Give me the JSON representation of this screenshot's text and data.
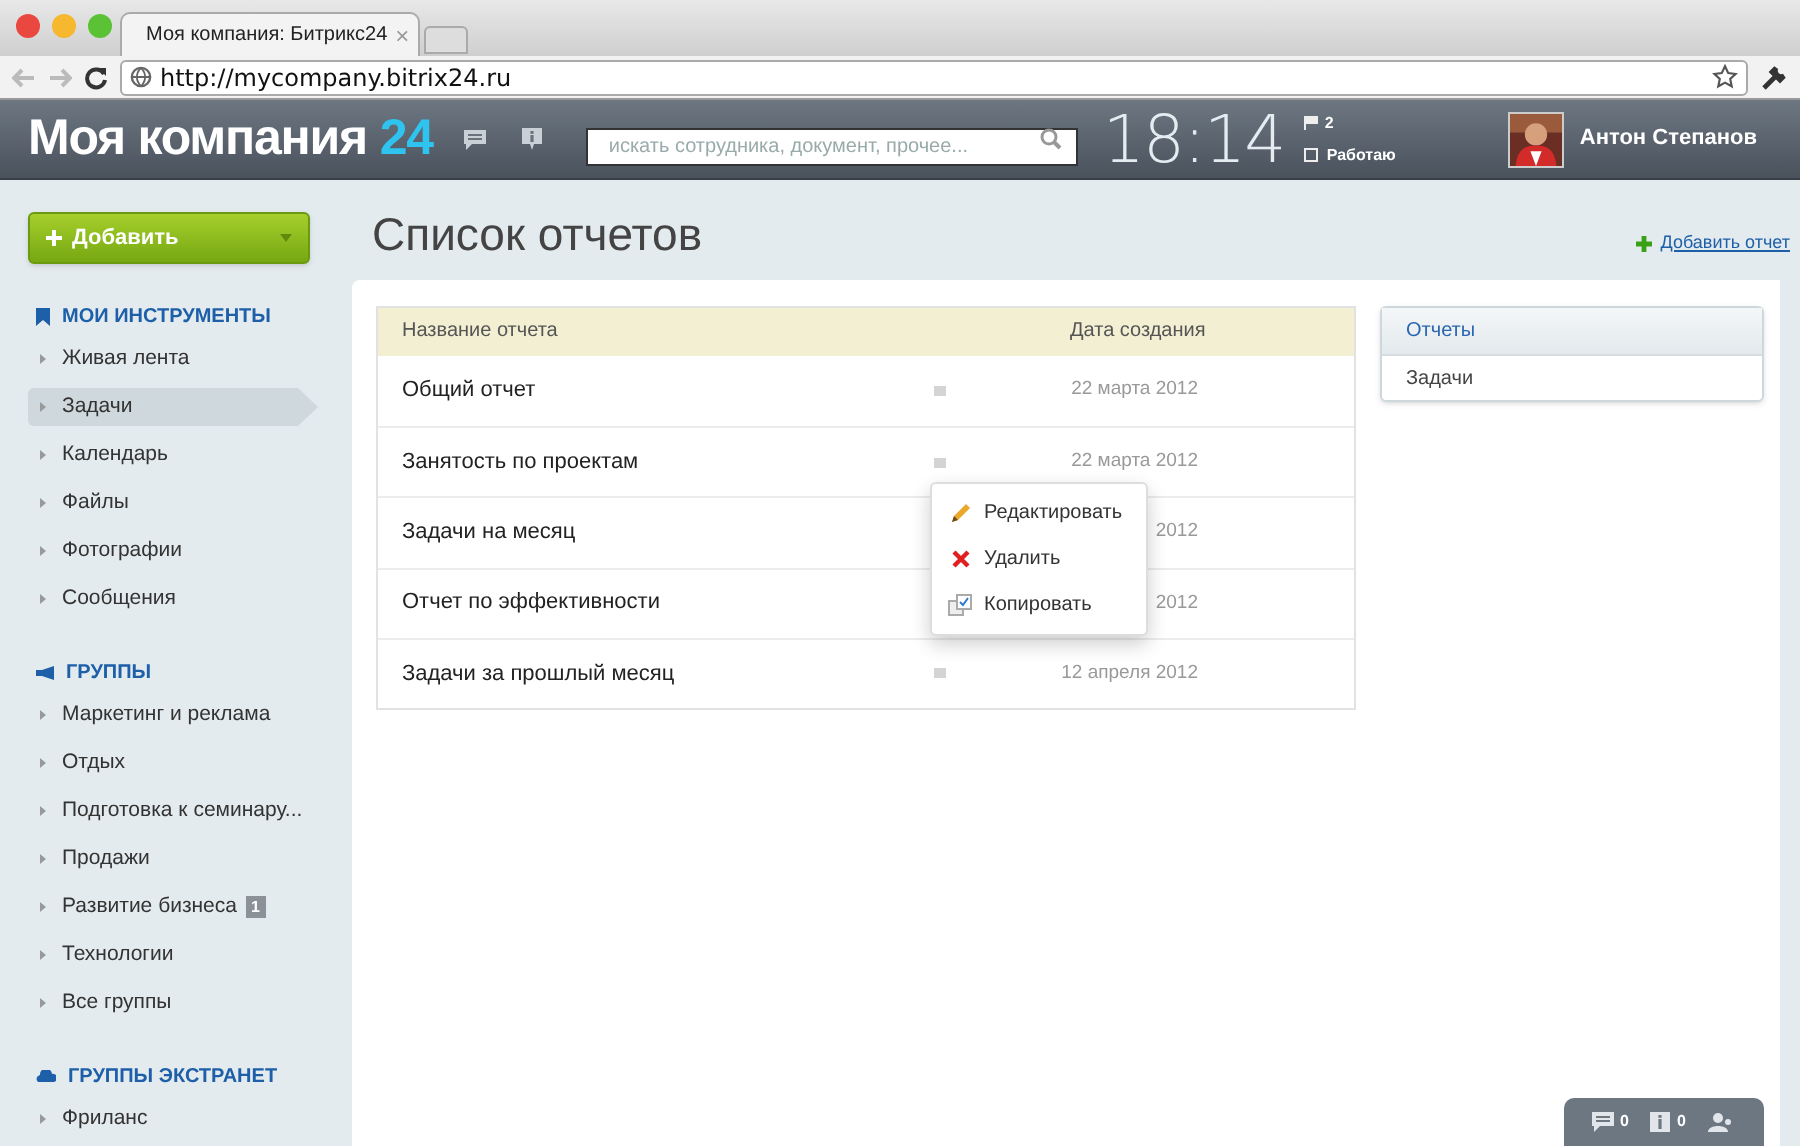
{
  "browser": {
    "tab_title": "Моя компания: Битрикс24",
    "tab_close": "×",
    "url": "http://mycompany.bitrix24.ru"
  },
  "header": {
    "logo": "Моя компания",
    "logo_number": "24",
    "search": {
      "placeholder": "искать сотрудника, документ, прочее..."
    },
    "clock": "18:14",
    "flag_count": "2",
    "status": {
      "label": "Работаю",
      "checked": false
    },
    "user_name": "Антон Степанов"
  },
  "add_button": "Добавить",
  "sidebar": [
    {
      "kind": "tools",
      "title": "МОИ ИНСТРУМЕНТЫ",
      "items": [
        {
          "label": "Живая лента",
          "selected": false
        },
        {
          "label": "Задачи",
          "selected": true
        },
        {
          "label": "Календарь",
          "selected": false
        },
        {
          "label": "Файлы",
          "selected": false
        },
        {
          "label": "Фотографии",
          "selected": false
        },
        {
          "label": "Сообщения",
          "selected": false
        }
      ]
    },
    {
      "kind": "groups",
      "title": "ГРУППЫ",
      "items": [
        {
          "label": "Маркетинг и реклама",
          "selected": false
        },
        {
          "label": "Отдых",
          "selected": false
        },
        {
          "label": "Подготовка к семинару...",
          "selected": false
        },
        {
          "label": "Продажи",
          "selected": false
        },
        {
          "label": "Развитие бизнеса",
          "selected": false,
          "badge": "1"
        },
        {
          "label": "Технологии",
          "selected": false
        },
        {
          "label": "Все группы",
          "selected": false
        }
      ]
    },
    {
      "kind": "extranet",
      "title": "ГРУППЫ ЭКСТРАНЕТ",
      "items": [
        {
          "label": "Фриланс",
          "selected": false
        }
      ]
    }
  ],
  "page_title": "Список отчетов",
  "add_report_link": "Добавить отчет",
  "table": {
    "columns": [
      "Название отчета",
      "Дата создания"
    ],
    "rows": [
      {
        "name": "Общий отчет",
        "date": "22 марта 2012"
      },
      {
        "name": "Занятость по проектам",
        "date": "22 марта 2012"
      },
      {
        "name": "Задачи на месяц",
        "date": "2012"
      },
      {
        "name": "Отчет по эффективности",
        "date": "2012"
      },
      {
        "name": "Задачи за прошлый месяц",
        "date": "12 апреля 2012"
      }
    ]
  },
  "context_menu": [
    {
      "kind": "edit",
      "label": "Редактировать"
    },
    {
      "kind": "delete",
      "label": "Удалить"
    },
    {
      "kind": "copy",
      "label": "Копировать"
    }
  ],
  "right_panel": {
    "title": "Отчеты",
    "items": [
      "Задачи"
    ]
  },
  "bottom_bar": {
    "messages": "0",
    "notifications": "0"
  }
}
